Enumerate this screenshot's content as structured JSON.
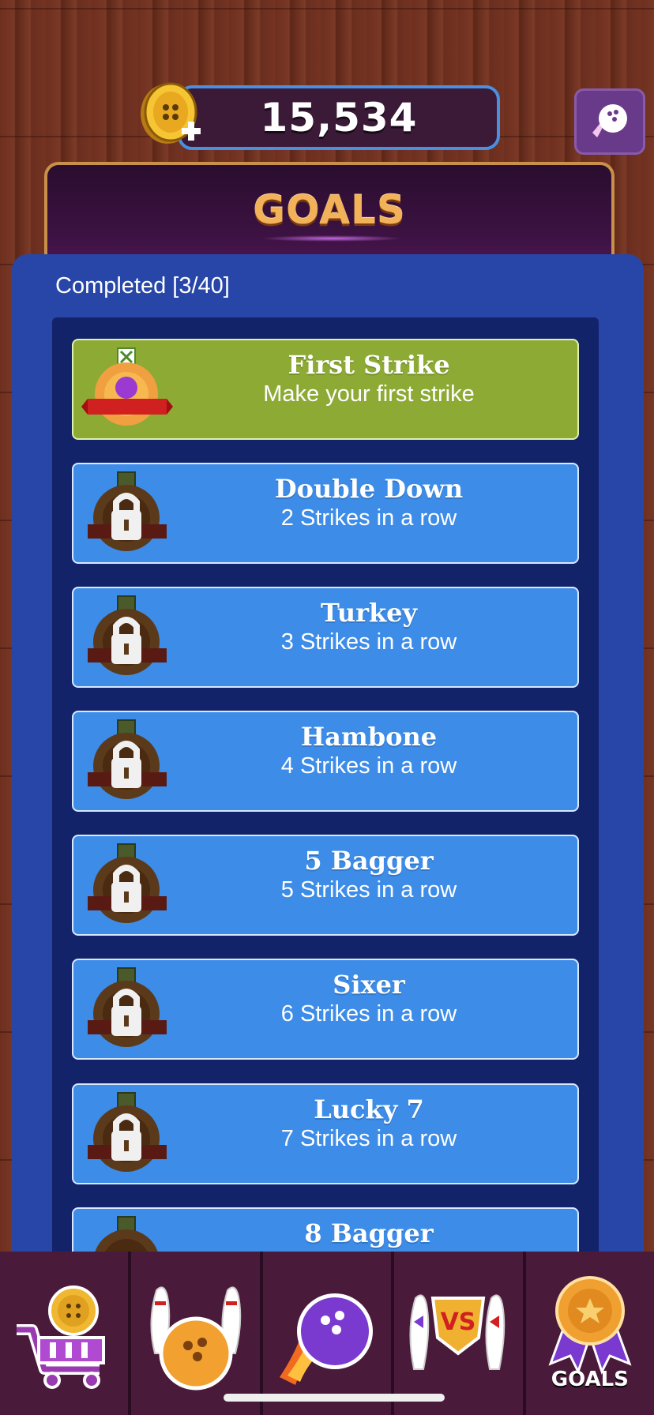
{
  "top_bar": {
    "coin_amount": "15,534"
  },
  "goals_header": {
    "title": "GOALS"
  },
  "progress": {
    "completed_label": "Completed [3/40]"
  },
  "goals": [
    {
      "title": "First Strike",
      "description": "Make your first strike",
      "status": "completed"
    },
    {
      "title": "Double Down",
      "description": "2 Strikes in a row",
      "status": "locked"
    },
    {
      "title": "Turkey",
      "description": "3 Strikes in a row",
      "status": "locked"
    },
    {
      "title": "Hambone",
      "description": "4 Strikes in a row",
      "status": "locked"
    },
    {
      "title": "5 Bagger",
      "description": "5 Strikes in a row",
      "status": "locked"
    },
    {
      "title": "Sixer",
      "description": "6 Strikes in a row",
      "status": "locked"
    },
    {
      "title": "Lucky 7",
      "description": "7 Strikes in a row",
      "status": "locked"
    },
    {
      "title": "8 Bagger",
      "description": "",
      "status": "locked"
    }
  ],
  "bottom_nav": {
    "tabs": [
      {
        "icon": "shop-cart-icon"
      },
      {
        "icon": "bowling-pins-ball-icon"
      },
      {
        "icon": "bowling-ball-fire-icon"
      },
      {
        "icon": "versus-pins-icon"
      },
      {
        "icon": "goals-medal-icon",
        "label": "GOALS"
      }
    ]
  },
  "colors": {
    "completed_card": "#8daa34",
    "locked_card": "#3d8ce8",
    "panel": "#2746a8",
    "goals_title": "#f2b25a",
    "coin_bar_border": "#4a8fe0"
  }
}
